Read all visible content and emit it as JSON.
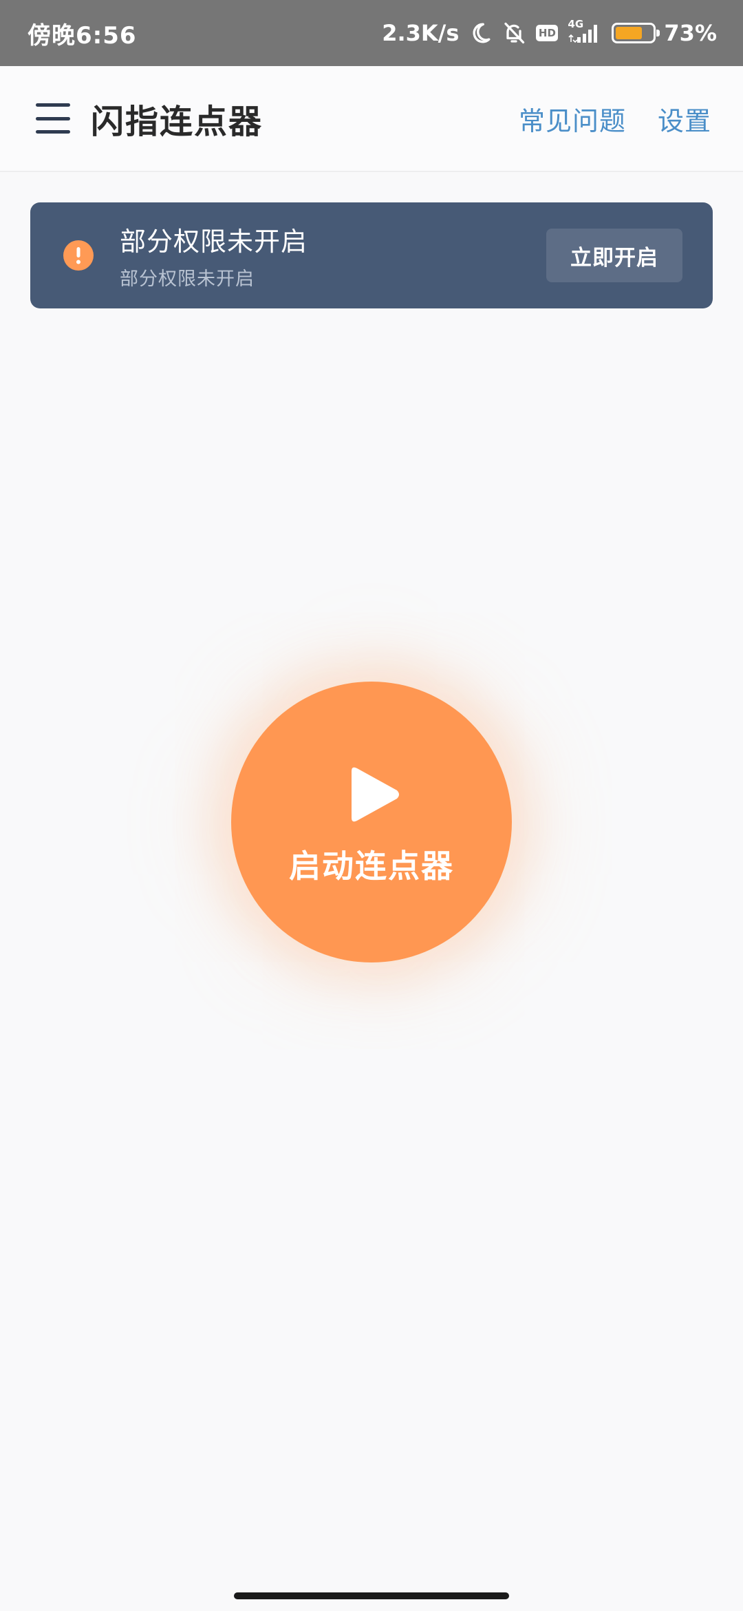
{
  "status_bar": {
    "time": "傍晚6:56",
    "net_speed": "2.3K/s",
    "hd": "HD",
    "network": "4G",
    "battery_percent": "73%",
    "battery_level": 0.73,
    "icons": [
      "moon-icon",
      "bell-off-icon",
      "hd-icon",
      "signal-icon",
      "battery-icon"
    ]
  },
  "app_bar": {
    "title": "闪指连点器",
    "faq_label": "常见问题",
    "settings_label": "设置",
    "menu_icon": "menu-icon"
  },
  "permission_banner": {
    "title": "部分权限未开启",
    "subtitle": "部分权限未开启",
    "button_label": "立即开启",
    "icon": "warning-icon"
  },
  "start_button": {
    "label": "启动连点器",
    "icon": "play-icon"
  },
  "colors": {
    "status_bar_bg": "#767676",
    "banner_bg": "#475a76",
    "accent_orange": "#ff9752",
    "link_blue": "#4a8ec8",
    "battery_fill": "#f5a623"
  }
}
